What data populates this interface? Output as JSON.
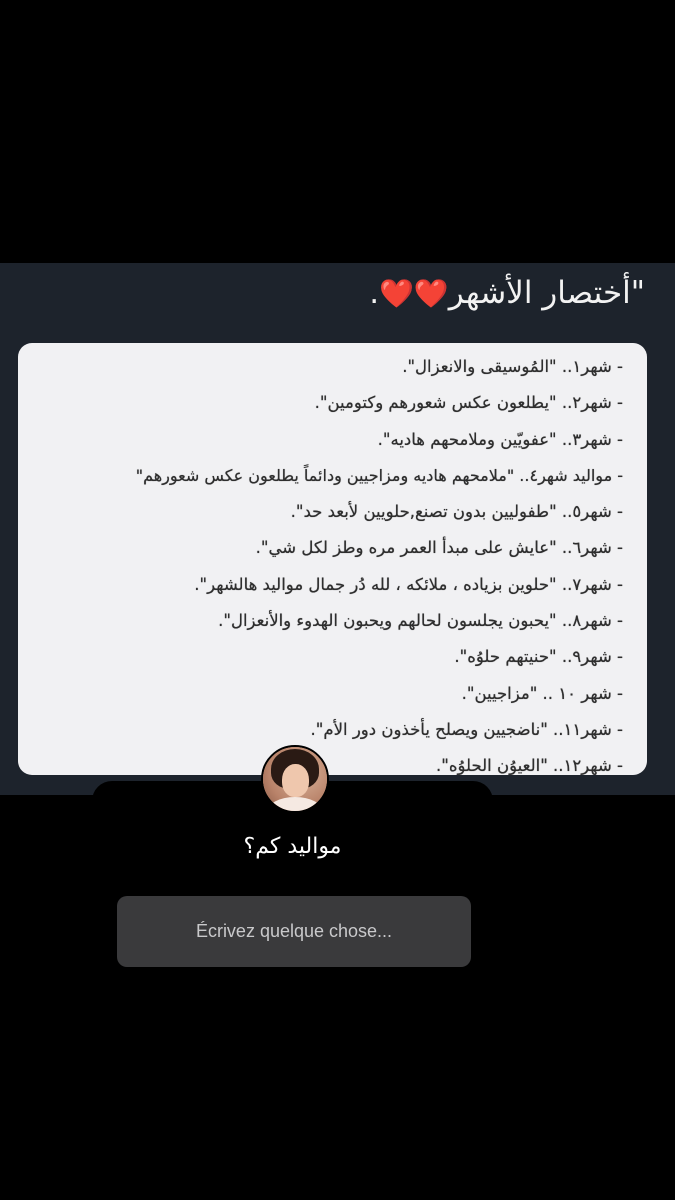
{
  "post": {
    "title": "\"أختصار الأشهر",
    "title_hearts": "❤️❤️",
    "title_end": ".",
    "lines": [
      "- شهر١.. \"المُوسيقى والانعزال\".",
      "- شهر٢.. \"يطلعون عكس شعورهم وكتومين\".",
      "- شهر٣.. \"عفويّين وملامحهم هاديه\".",
      "- مواليد شهر٤.. \"ملامحهم هاديه ومزاجيين ودائماً يطلعون عكس شعورهم\"",
      "- شهر٥.. \"طفوليين بدون تصنع,حلويين لأبعد حد\".",
      "- شهر٦.. \"عايش على مبدأ العمر مره وطز لكل شي\".",
      "- شهر٧.. \"حلوين بزياده ، ملائكه ، لله دُر جمال مواليد هالشهر\".",
      "- شهر٨.. \"يحبون يجلسون لحالهم ويحبون الهدوء والأنعزال\".",
      "- شهر٩.. \"حنيتهم حلوُه\".",
      "- شهر ١٠ .. \"مزاجيين\".",
      "- شهر١١.. \"ناضجيين ويصلح يأخذون دور الأم\".",
      "- شهر١٢.. \"العيوُن الحلوُه\"."
    ]
  },
  "question_sticker": {
    "question": "مواليد كم؟",
    "placeholder": "Écrivez quelque chose..."
  }
}
